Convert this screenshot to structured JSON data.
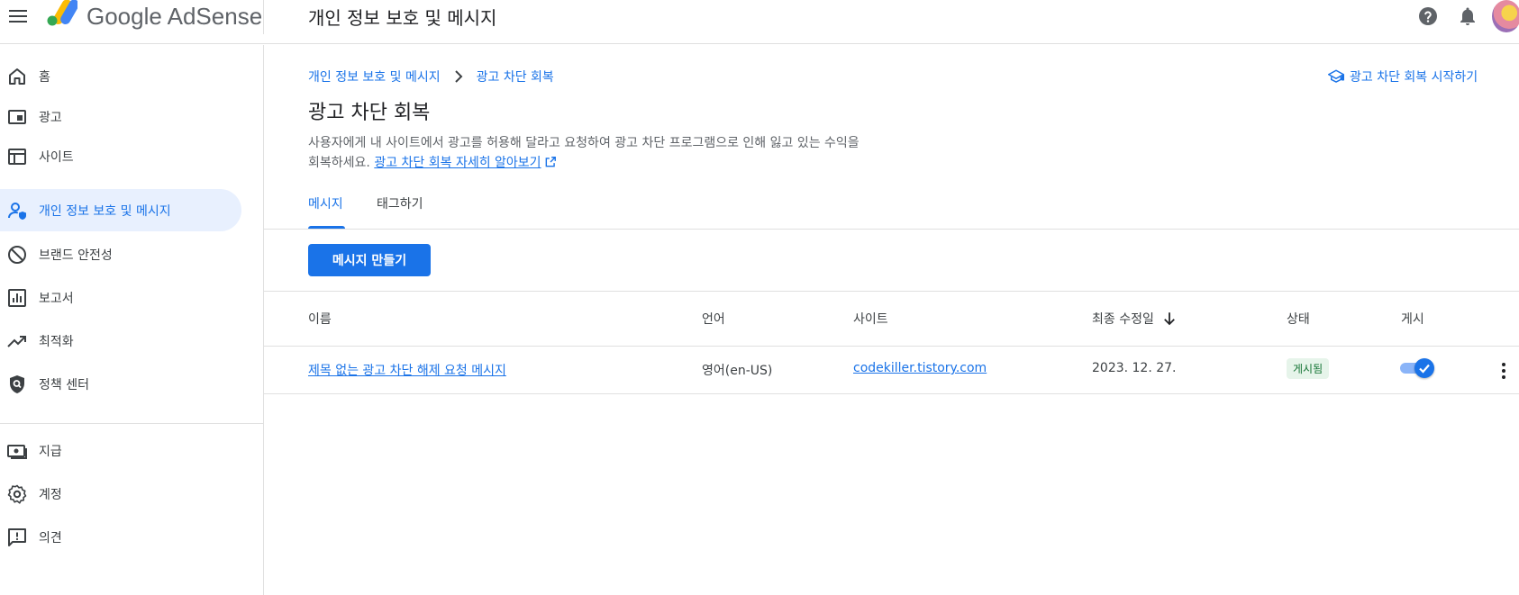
{
  "header": {
    "app_name": "Google AdSense",
    "page_heading": "개인 정보 보호 및 메시지",
    "icons": [
      "menu-icon",
      "help-icon",
      "notifications-icon",
      "avatar"
    ]
  },
  "sidebar": {
    "items": [
      {
        "label": "홈",
        "icon": "home-icon"
      },
      {
        "label": "광고",
        "icon": "ads-icon"
      },
      {
        "label": "사이트",
        "icon": "sites-icon"
      },
      {
        "label": "개인 정보 보호 및 메시지",
        "icon": "privacy-icon",
        "active": true
      },
      {
        "label": "브랜드 안전성",
        "icon": "block-icon"
      },
      {
        "label": "보고서",
        "icon": "reports-icon"
      },
      {
        "label": "최적화",
        "icon": "trending-icon"
      },
      {
        "label": "정책 센터",
        "icon": "policy-shield-icon"
      },
      {
        "label": "지급",
        "icon": "payments-icon"
      },
      {
        "label": "계정",
        "icon": "settings-gear-icon"
      },
      {
        "label": "의견",
        "icon": "feedback-icon"
      }
    ]
  },
  "main": {
    "breadcrumb": [
      "개인 정보 보호 및 메시지",
      "광고 차단 회복"
    ],
    "start_link": "광고 차단 회복 시작하기",
    "title": "광고 차단 회복",
    "description": "사용자에게 내 사이트에서 광고를 허용해 달라고 요청하여 광고 차단 프로그램으로 인해 잃고 있는 수익을 회복하세요.",
    "learn_more": "광고 차단 회복 자세히 알아보기",
    "tabs": [
      {
        "label": "메시지",
        "active": true
      },
      {
        "label": "태그하기",
        "active": false
      }
    ],
    "create_button": "메시지 만들기",
    "table": {
      "headers": [
        "이름",
        "언어",
        "사이트",
        "최종 수정일",
        "상태",
        "게시"
      ],
      "sort": {
        "column": "최종 수정일",
        "direction": "descending"
      },
      "rows": [
        {
          "name": "제목 없는 광고 차단 해제 요청 메시지",
          "language": "영어(en-US)",
          "site": "codekiller.tistory.com",
          "modified": "2023. 12. 27.",
          "status": "게시됨",
          "published": true
        }
      ]
    }
  },
  "colors": {
    "accent": "#1a73e8",
    "active_nav_bg": "#e8f0fe",
    "status_bg": "#e6f4ea",
    "status_text": "#137333"
  }
}
